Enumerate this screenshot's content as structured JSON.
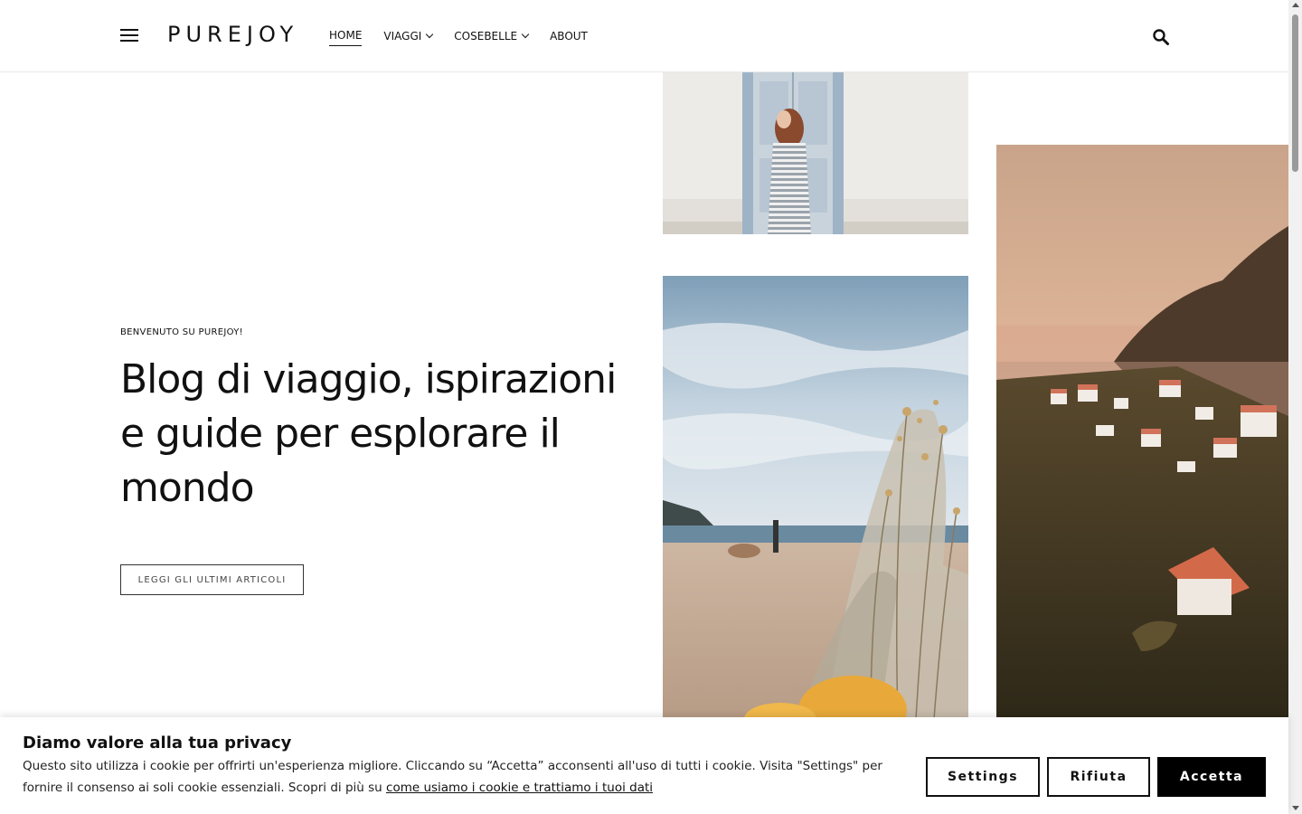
{
  "header": {
    "logo": "PUREJOY",
    "nav": [
      {
        "label": "HOME",
        "active": true,
        "has_dropdown": false
      },
      {
        "label": "VIAGGI",
        "active": false,
        "has_dropdown": true
      },
      {
        "label": "COSEBELLE",
        "active": false,
        "has_dropdown": true
      },
      {
        "label": "ABOUT",
        "active": false,
        "has_dropdown": false
      }
    ],
    "menu_icon": "hamburger-icon",
    "search_icon": "search-icon"
  },
  "hero": {
    "kicker": "BENVENUTO SU PUREJOY!",
    "title": "Blog di viaggio, ispirazioni e guide per esplorare il mondo",
    "button": "LEGGI GLI ULTIMI ARTICOLI"
  },
  "cookie": {
    "title": "Diamo valore alla tua privacy",
    "text": "Questo sito utilizza i cookie per offrirti un'esperienza migliore. Cliccando su “Accetta” acconsenti all'uso di tutti i cookie. Visita \"Settings\" per fornire il consenso ai soli cookie essenziali. Scopri di più su ",
    "link": "come usiamo i cookie e trattiamo i tuoi dati",
    "settings": "Settings",
    "reject": "Rifiuta",
    "accept": "Accetta"
  },
  "colors": {
    "text": "#111111",
    "accept_bg": "#000000",
    "border": "#e8e8e8"
  }
}
